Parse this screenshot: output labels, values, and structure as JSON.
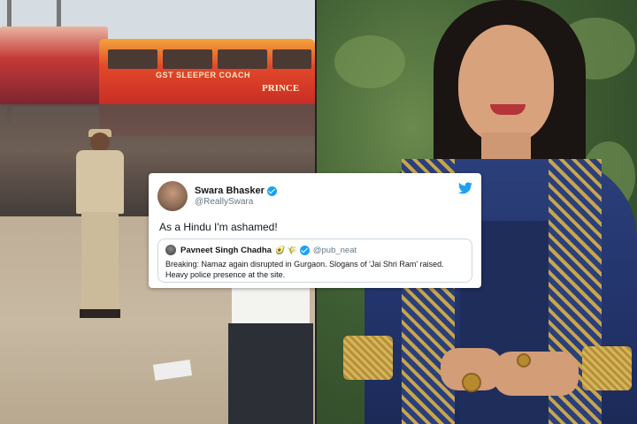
{
  "tweet": {
    "author_name": "Swara Bhasker",
    "author_handle": "@ReallySwara",
    "text": "As a Hindu I'm ashamed!",
    "icon": "twitter-bird-icon",
    "verified_color": "#1da1f2",
    "quoted": {
      "author_name": "Pavneet Singh Chadha",
      "emoji": "🥑 🌾",
      "author_handle": "@pub_neat",
      "text": "Breaking: Namaz again disrupted in Gurgaon. Slogans of 'Jai Shri Ram' raised. Heavy police presence at the site."
    }
  },
  "left_photo": {
    "bus_text": "GST SLEEPER COACH",
    "bus_brand": "PRINCE"
  }
}
